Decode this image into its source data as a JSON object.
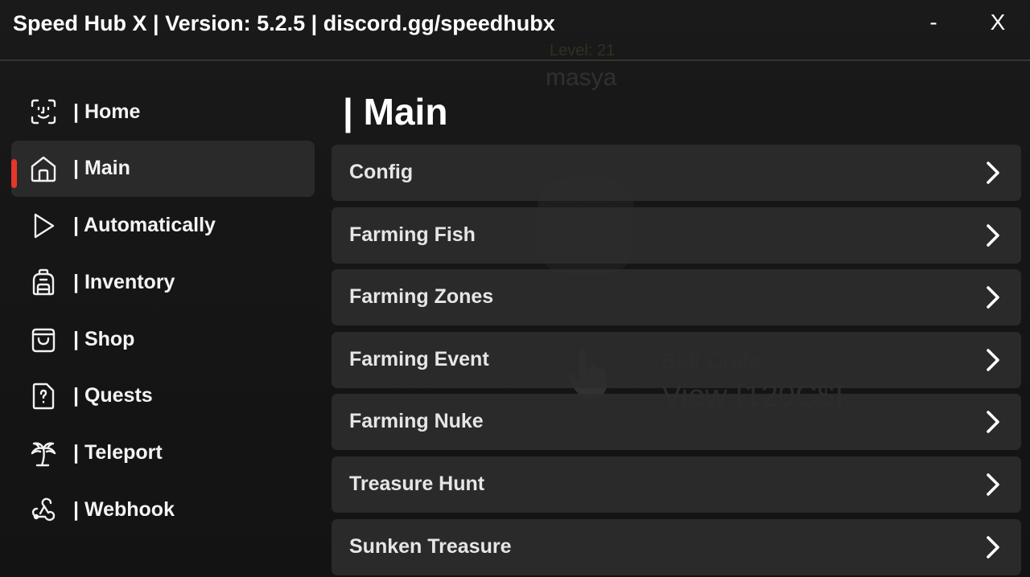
{
  "window": {
    "title": "Speed Hub X | Version: 5.2.5 | discord.gg/speedhubx",
    "minimize_label": "-",
    "close_label": "X"
  },
  "background": {
    "level_text": "Level: 21",
    "player_name": "masya",
    "bait_title": "Bait Crate",
    "bait_price": "View [120C$]"
  },
  "sidebar": {
    "items": [
      {
        "label": "| Home",
        "icon": "face-scan-icon",
        "active": false
      },
      {
        "label": "| Main",
        "icon": "home-icon",
        "active": true
      },
      {
        "label": "| Automatically",
        "icon": "play-icon",
        "active": false
      },
      {
        "label": "| Inventory",
        "icon": "backpack-icon",
        "active": false
      },
      {
        "label": "| Shop",
        "icon": "shopping-bag-icon",
        "active": false
      },
      {
        "label": "| Quests",
        "icon": "question-file-icon",
        "active": false
      },
      {
        "label": "| Teleport",
        "icon": "palm-tree-icon",
        "active": false
      },
      {
        "label": "| Webhook",
        "icon": "webhook-icon",
        "active": false
      }
    ]
  },
  "main": {
    "title": "| Main",
    "sections": [
      {
        "label": "Config"
      },
      {
        "label": "Farming Fish"
      },
      {
        "label": "Farming Zones"
      },
      {
        "label": "Farming Event"
      },
      {
        "label": "Farming Nuke"
      },
      {
        "label": "Treasure Hunt"
      },
      {
        "label": "Sunken Treasure"
      }
    ]
  },
  "colors": {
    "accent": "#e5372a",
    "panel": "#2c2c2c",
    "background": "#161616",
    "text": "#f2f2f2"
  }
}
